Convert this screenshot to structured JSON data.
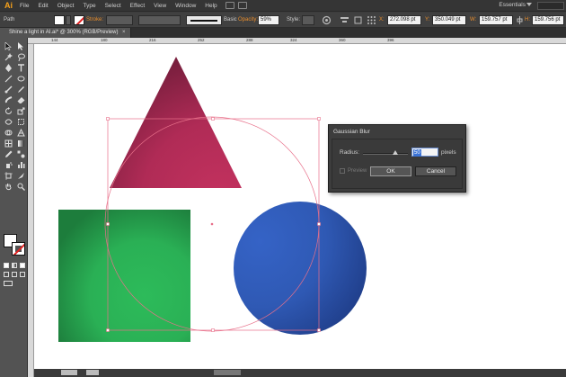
{
  "app": {
    "logo": "Ai",
    "menu": [
      "File",
      "Edit",
      "Object",
      "Type",
      "Select",
      "Effect",
      "View",
      "Window",
      "Help"
    ],
    "workspace": "Essentials"
  },
  "control_bar": {
    "selection_label": "Path",
    "stroke_label": "Stroke:",
    "brush_label": "Basic",
    "opacity_label": "Opacity:",
    "opacity_value": "59%",
    "style_label": "Style:",
    "x_label": "X:",
    "x_value": "272.098 pt",
    "y_label": "Y:",
    "y_value": "350.049 pt",
    "w_label": "W:",
    "w_value": "159.757 pt",
    "h_label": "H:",
    "h_value": "159.756 pt"
  },
  "document": {
    "tab_title": "Shine a light in AI.ai* @ 300% (RGB/Preview)",
    "tab_close": "×"
  },
  "ruler": {
    "top_ticks": [
      "144",
      "180",
      "216",
      "252",
      "288",
      "324",
      "360",
      "396"
    ]
  },
  "dialog": {
    "title": "Gaussian Blur",
    "radius_label": "Radius:",
    "radius_value": "50",
    "radius_fraction": 0.72,
    "unit_label": "pixels",
    "preview_label": "Preview",
    "preview_checked": false,
    "ok_label": "OK",
    "cancel_label": "Cancel"
  },
  "colors": {
    "triangle": "#c4325f",
    "triangle_shade": "#7a1f3e",
    "square": "#2dbb5a",
    "square_shade": "#1d7d3c",
    "circle": "#3563c6",
    "circle_shade": "#1f3d88",
    "selection": "#e8708a"
  }
}
